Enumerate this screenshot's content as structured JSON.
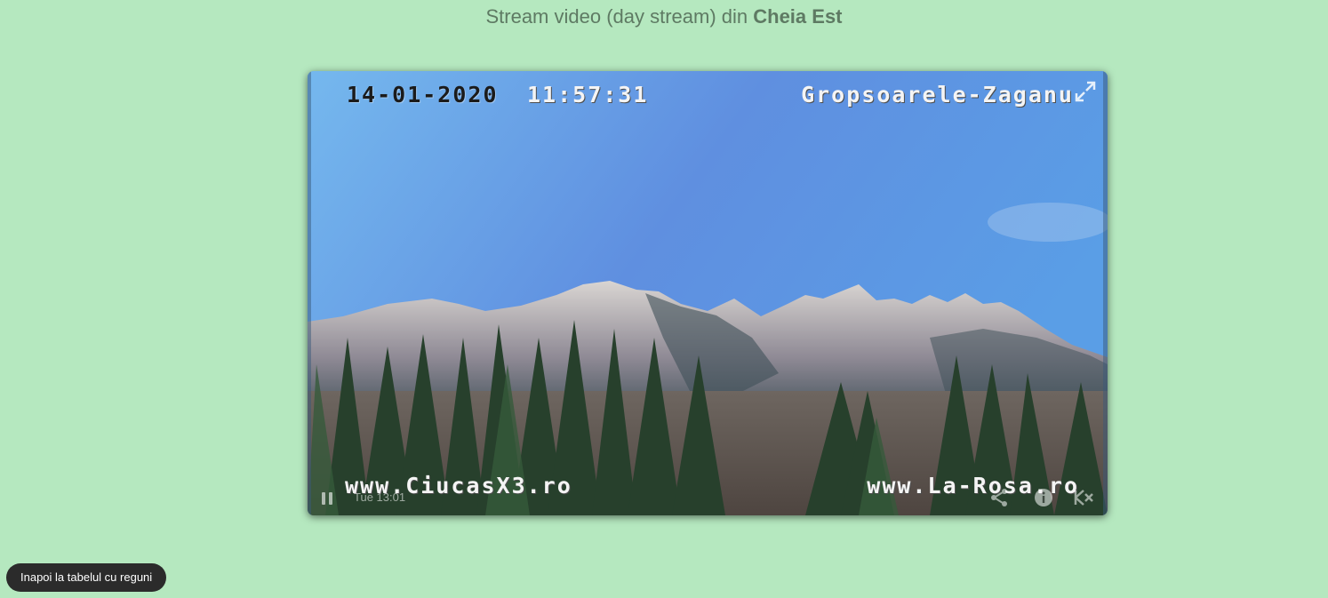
{
  "header": {
    "title_prefix": "Stream video (day stream) din ",
    "title_location": "Cheia Est"
  },
  "player": {
    "osd_date": "14-01-2020",
    "osd_time": "11:57:31",
    "osd_location": "Gropsoarele-Zaganu",
    "osd_left_url": "www.CiucasX3.ro",
    "osd_right_url": "www.La-Rosa.ro",
    "time_label": "Tue 13:01",
    "icons": {
      "fullscreen": "fullscreen-icon",
      "pause": "pause-icon",
      "share": "share-icon",
      "info": "info-icon",
      "brand": "brand-icon"
    }
  },
  "footer": {
    "back_label": "Inapoi la tabelul cu reguni"
  },
  "colors": {
    "page_background": "#b5e8bf",
    "title_text": "#5e7a63",
    "button_background": "#2b2b2b"
  }
}
